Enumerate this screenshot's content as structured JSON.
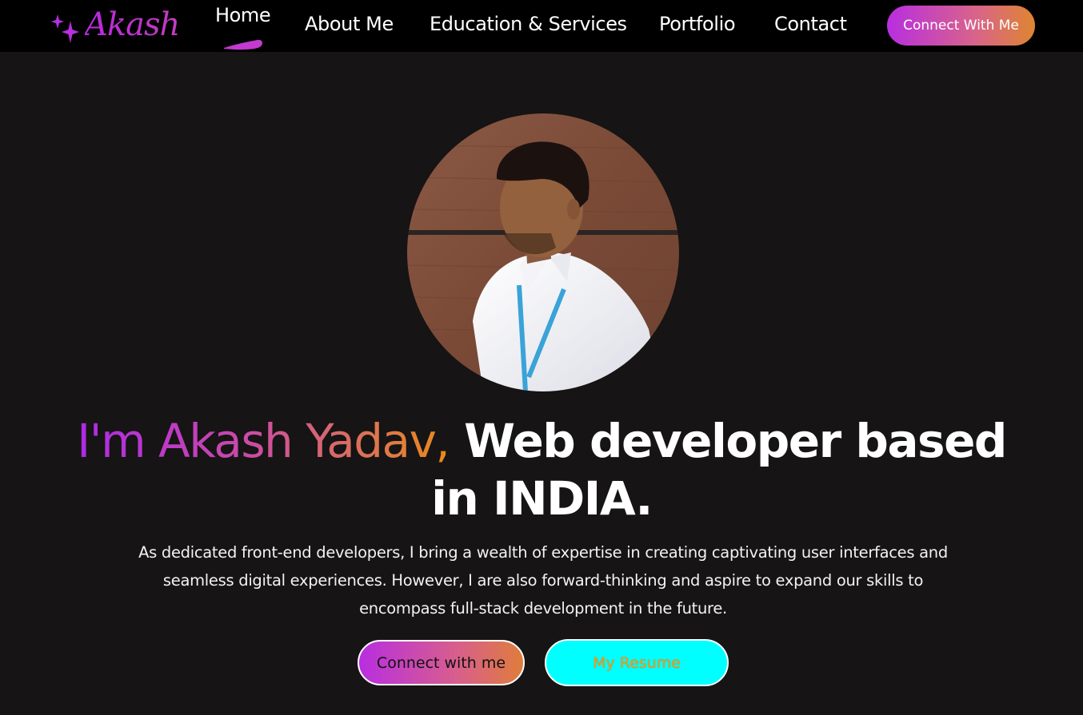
{
  "nav": {
    "logo_text": "Akash",
    "items": [
      {
        "label": "Home",
        "active": true
      },
      {
        "label": "About Me"
      },
      {
        "label": "Education & Services"
      },
      {
        "label": "Portfolio"
      },
      {
        "label": "Contact"
      }
    ],
    "cta_label": "Connect With Me"
  },
  "hero": {
    "headline_name": "I'm Akash Yadav,",
    "headline_rest": "Web developer based in INDIA.",
    "description": "As dedicated front-end developers, I bring a wealth of expertise in creating captivating user interfaces and seamless digital experiences. However, I are also forward-thinking and aspire to expand our skills to encompass full-stack development in the future.",
    "primary_button": "Connect with me",
    "secondary_button": "My Resume"
  },
  "colors": {
    "background": "#161414",
    "nav_background": "#000000",
    "accent_purple": "#b82ee0",
    "accent_orange": "#e98b1a",
    "resume_button": "#00ffff"
  }
}
